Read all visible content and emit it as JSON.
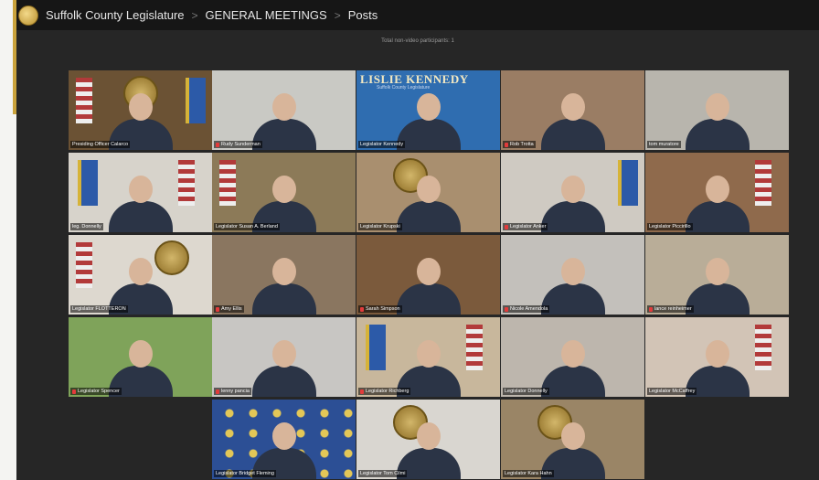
{
  "header": {
    "breadcrumb": [
      "Suffolk County Legislature",
      "GENERAL MEETINGS",
      "Posts"
    ],
    "separator": ">"
  },
  "meeting": {
    "participants_text": "Total non-video participants: 1",
    "banner_name": "LISLIE KENNEDY",
    "banner_subtitle": "Suffolk County Legislature",
    "tiles": [
      {
        "label": "Presiding Officer Calarco",
        "muted": false,
        "bg": "#6b5234"
      },
      {
        "label": "Rudy Sunderman",
        "muted": true,
        "bg": "#c9c9c4"
      },
      {
        "label": "Legislator Kennedy",
        "muted": false,
        "bg": "#2f6db0"
      },
      {
        "label": "Rob Trotta",
        "muted": true,
        "bg": "#9a7d64"
      },
      {
        "label": "tom muratore",
        "muted": false,
        "bg": "#b8b5ad"
      },
      {
        "label": "leg. Donnelly",
        "muted": false,
        "bg": "#d7d3cb"
      },
      {
        "label": "Legislator Susan A. Berland",
        "muted": false,
        "bg": "#8c7a58"
      },
      {
        "label": "Legislator Krupski",
        "muted": false,
        "bg": "#a98f6f"
      },
      {
        "label": "Legislator Anker",
        "muted": true,
        "bg": "#cfcac2"
      },
      {
        "label": "Legislator Piccirillo",
        "muted": false,
        "bg": "#8f6a4c"
      },
      {
        "label": "Legislator FLOTTERON",
        "muted": false,
        "bg": "#ddd8cf"
      },
      {
        "label": "Amy Ellis",
        "muted": true,
        "bg": "#8a7660"
      },
      {
        "label": "Sarah Simpson",
        "muted": true,
        "bg": "#7b5a3c"
      },
      {
        "label": "Nicole Amendola",
        "muted": true,
        "bg": "#c3c0bb"
      },
      {
        "label": "lance reinheimer",
        "muted": true,
        "bg": "#b9ad98"
      },
      {
        "label": "Legislator Spencer",
        "muted": true,
        "bg": "#7fa35a"
      },
      {
        "label": "lenny pancia",
        "muted": true,
        "bg": "#c8c6c3"
      },
      {
        "label": "Legislator Richberg",
        "muted": true,
        "bg": "#c8b79c"
      },
      {
        "label": "Legislator Donnelly",
        "muted": false,
        "bg": "#bdb6ad"
      },
      {
        "label": "Legislator McCaffrey",
        "muted": false,
        "bg": "#d2c4b6"
      },
      {
        "label": "Legislator Bridget Fleming",
        "muted": false,
        "bg": "#2c4f95"
      },
      {
        "label": "Legislator Tom Cilmi",
        "muted": false,
        "bg": "#d9d6d0"
      },
      {
        "label": "Legislator Kara Hahn",
        "muted": false,
        "bg": "#9a8566"
      }
    ]
  }
}
